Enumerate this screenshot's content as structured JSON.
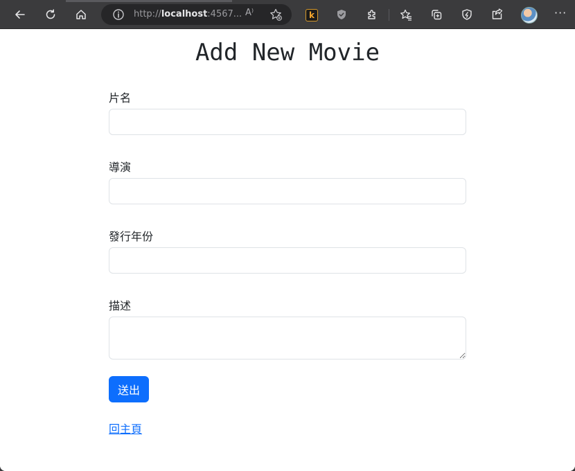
{
  "browser": {
    "url_prefix": "http://",
    "url_host": "localhost",
    "url_rest": ":4567...",
    "read_aloud_label": "A⁾",
    "k_extension_label": "k",
    "more_label": "···",
    "icons": [
      "back-icon",
      "refresh-icon",
      "home-icon",
      "info-icon",
      "read-aloud-icon",
      "add-favorite-icon",
      "k-extension-icon",
      "shield-icon",
      "extensions-icon",
      "favorites-icon",
      "collections-icon",
      "browser-essentials-icon",
      "share-icon",
      "avatar",
      "more-icon"
    ]
  },
  "page": {
    "title": "Add New Movie",
    "fields": {
      "movie_name": {
        "label": "片名",
        "value": ""
      },
      "director": {
        "label": "導演",
        "value": ""
      },
      "release_year": {
        "label": "發行年份",
        "value": ""
      },
      "description": {
        "label": "描述",
        "value": ""
      }
    },
    "submit_label": "送出",
    "home_link_label": "回主頁"
  },
  "colors": {
    "primary": "#0d6efd",
    "toolbar": "#3b3b3d",
    "text": "#212529"
  }
}
